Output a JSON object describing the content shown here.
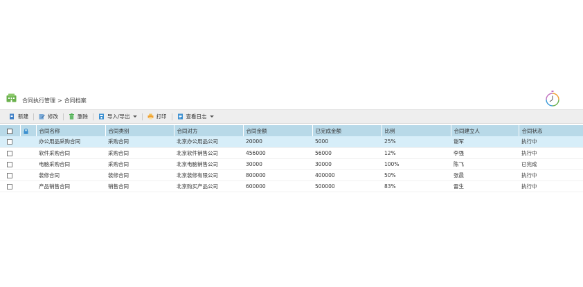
{
  "breadcrumb": {
    "parent": "合同执行管理",
    "separator": ">",
    "current": "合同档案"
  },
  "toolbar": {
    "new_label": "新建",
    "edit_label": "修改",
    "delete_label": "删除",
    "import_export_label": "导入/导出",
    "print_label": "打印",
    "log_label": "查看日志"
  },
  "table": {
    "columns": [
      "合同名称",
      "合同类别",
      "合同对方",
      "合同金额",
      "已完成金额",
      "比例",
      "合同建立人",
      "合同状态"
    ],
    "rows": [
      [
        "办公用品采购合同",
        "采购合同",
        "北京办公用品公司",
        "20000",
        "5000",
        "25%",
        "谢军",
        "执行中"
      ],
      [
        "软件采购合同",
        "采购合同",
        "北京软件销售公司",
        "456000",
        "56000",
        "12%",
        "李强",
        "执行中"
      ],
      [
        "电脑采购合同",
        "采购合同",
        "北京电脑销售公司",
        "30000",
        "30000",
        "100%",
        "陈飞",
        "已完成"
      ],
      [
        "装修合同",
        "装修合同",
        "北京装修有限公司",
        "800000",
        "400000",
        "50%",
        "张晨",
        "执行中"
      ],
      [
        "产品销售合同",
        "销售合同",
        "北京购买产品公司",
        "600000",
        "500000",
        "83%",
        "雷生",
        "执行中"
      ]
    ]
  },
  "colors": {
    "header_row": "#b8d9e8",
    "selected_row": "#d7eef9",
    "toolbar_bg": "#eeeeee",
    "app_icon": "#6ab04c"
  },
  "icons": {
    "app": "building-icon",
    "clock": "clock-icon",
    "lock": "lock-icon",
    "new": "new-doc-icon",
    "edit": "edit-icon",
    "delete": "trash-icon",
    "import_export": "import-export-icon",
    "print": "printer-icon",
    "log": "log-icon"
  }
}
